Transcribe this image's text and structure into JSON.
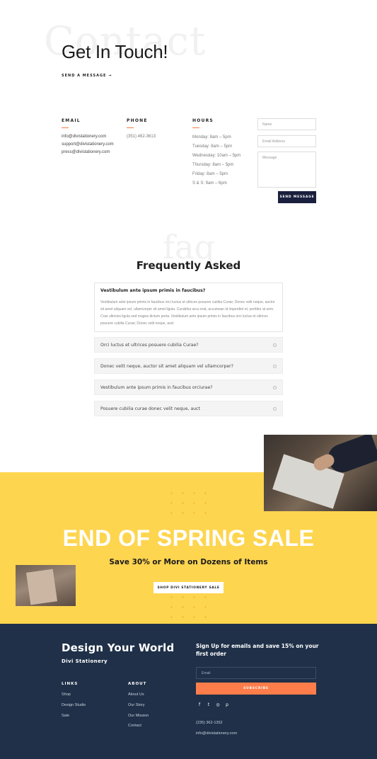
{
  "hero": {
    "ghost_word": "Contact",
    "title": "Get In Touch!",
    "send_link": "SEND A MESSAGE →"
  },
  "email": {
    "heading": "EMAIL",
    "lines": [
      "info@divistationery.com",
      "support@divistationery.com",
      "press@divistationery.com"
    ]
  },
  "phone": {
    "heading": "PHONE",
    "lines": [
      "(351) 462-3613"
    ]
  },
  "hours": {
    "heading": "HOURS",
    "lines": [
      "Monday: 8am – 5pm",
      "Tuesday: 8am – 5pm",
      "Wednesday: 10am – 5pm",
      "Thursday: 8am – 5pm",
      "Friday: 8am – 5pm",
      "S & S: 9am – 6pm"
    ]
  },
  "form": {
    "name_placeholder": "Name",
    "email_placeholder": "Email Address",
    "message_placeholder": "Message",
    "send_label": "SEND MESSAGE"
  },
  "faq": {
    "ghost_word": "faq",
    "title": "Frequently Asked",
    "open_question": "Vestibulum ante ipsum primis in faucibus?",
    "open_answer": "Vestibulum ante ipsum primis in faucibus orci luctus et ultrices posuere cubilia Curae; Donec velit neque, auctor sit amet aliquam vel, ullamcorper sit amet ligula. Curabitur arcu erat, accumsan id imperdiet et, porttitor at sem. Cras ultricies ligula sed magna dictum porta. Vestibulum ante ipsum primis in faucibus orci luctus et ultrices posuere cubilia Curae; Donec velit neque, auct",
    "items": [
      "Orci luctus et ultrices posuere cubilia Curae?",
      "Donec velit neque, auctor sit amet aliquam vel ullamcorper?",
      "Vestibulum ante ipsum primis in faucibus orciurae?",
      "Posuere cubilia curae donec velit neque, auct"
    ]
  },
  "sale": {
    "title": "END OF SPRING SALE",
    "subtitle": "Save 30% or More on Dozens of Items",
    "button": "SHOP DIVI STATIONERY SALE"
  },
  "footer": {
    "brand": "Design Your World",
    "sub": "Divi Stationery",
    "links_heading": "LINKS",
    "links": [
      "Shop",
      "Design Studio",
      "Sale"
    ],
    "about_heading": "ABOUT",
    "about": [
      "About Us",
      "Our Story",
      "Our Mission",
      "Contact"
    ],
    "signup": "Sign Up for emails and save 15% on your first order",
    "email_placeholder": "Email",
    "subscribe": "SUBSCRIBE",
    "social": [
      "f",
      "t",
      "◎",
      "p"
    ],
    "phone": "(235) 362-1352",
    "email": "info@divistationery.com"
  },
  "colors": {
    "accent": "#ff7a45",
    "navy": "#1a1f3d",
    "sale_yellow": "#fed54f",
    "footer_bg": "#1f3048"
  }
}
